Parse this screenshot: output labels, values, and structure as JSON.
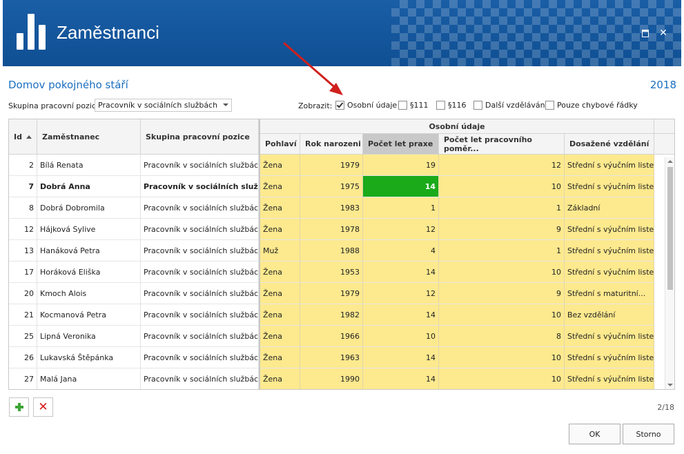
{
  "window": {
    "title": "Zaměstnanci",
    "maximize_icon": "maximize-icon",
    "close_glyph": "✕"
  },
  "header": {
    "organization": "Domov pokojného stáří",
    "year": "2018"
  },
  "filter": {
    "group_label": "Skupina pracovní pozice:",
    "group_value": "Pracovník v sociálních službách",
    "show_label": "Zobrazit:",
    "checkboxes": [
      {
        "label": "Osobní údaje",
        "checked": true
      },
      {
        "label": "§111",
        "checked": false
      },
      {
        "label": "§116",
        "checked": false
      },
      {
        "label": "Další vzdělávání",
        "checked": false
      },
      {
        "label": "Pouze chybové řádky",
        "checked": false
      }
    ]
  },
  "colors": {
    "titlebar": "#1a5ea6",
    "accent_text": "#1a6fc0",
    "highlight_yellow": "#fde98e",
    "highlight_green": "#1aaa1a",
    "annotation_arrow": "#d0201c"
  },
  "grid": {
    "group_header": "Osobní údaje",
    "columns": {
      "id": "Id",
      "employee": "Zaměstnanec",
      "group": "Skupina pracovní pozice",
      "gender": "Pohlaví",
      "birth_year": "Rok narozeni",
      "practice_years": "Počet let praxe",
      "employment_years": "Počet let pracovního poměr...",
      "education": "Dosažené vzdělání"
    },
    "rows": [
      {
        "id": "2",
        "name": "Bílá Renata",
        "group": "Pracovník v sociálních službách",
        "gender": "Žena",
        "birth": "1979",
        "practice": "19",
        "employment": "12",
        "education": "Střední s výučním listem"
      },
      {
        "id": "7",
        "name": "Dobrá Anna",
        "group": "Pracovník v sociálních službách",
        "gender": "Žena",
        "birth": "1975",
        "practice": "14",
        "employment": "10",
        "education": "Střední s výučním listem"
      },
      {
        "id": "8",
        "name": "Dobrá Dobromila",
        "group": "Pracovník v sociálních službách",
        "gender": "Žena",
        "birth": "1983",
        "practice": "1",
        "employment": "1",
        "education": "Základní"
      },
      {
        "id": "12",
        "name": "Hájková Sylive",
        "group": "Pracovník v sociálních službách",
        "gender": "Žena",
        "birth": "1978",
        "practice": "12",
        "employment": "9",
        "education": "Střední s výučním listem"
      },
      {
        "id": "13",
        "name": "Hanáková Petra",
        "group": "Pracovník v sociálních službách",
        "gender": "Muž",
        "birth": "1988",
        "practice": "4",
        "employment": "1",
        "education": "Střední s výučním listem"
      },
      {
        "id": "17",
        "name": "Horáková Eliška",
        "group": "Pracovník v sociálních službách",
        "gender": "Žena",
        "birth": "1953",
        "practice": "14",
        "employment": "10",
        "education": "Střední s výučním listem"
      },
      {
        "id": "20",
        "name": "Kmoch Alois",
        "group": "Pracovník v sociálních službách",
        "gender": "Žena",
        "birth": "1979",
        "practice": "12",
        "employment": "9",
        "education": "Střední s maturitní..."
      },
      {
        "id": "21",
        "name": "Kocmanová Petra",
        "group": "Pracovník v sociálních službách",
        "gender": "Žena",
        "birth": "1982",
        "practice": "14",
        "employment": "10",
        "education": "Bez vzdělání"
      },
      {
        "id": "25",
        "name": "Lipná Veronika",
        "group": "Pracovník v sociálních službách",
        "gender": "Žena",
        "birth": "1966",
        "practice": "10",
        "employment": "8",
        "education": "Střední s výučním listem"
      },
      {
        "id": "26",
        "name": "Lukavská Štěpánka",
        "group": "Pracovník v sociálních službách",
        "gender": "Žena",
        "birth": "1963",
        "practice": "14",
        "employment": "10",
        "education": "Střední s výučním listem"
      },
      {
        "id": "27",
        "name": "Malá Jana",
        "group": "Pracovník v sociálních službách",
        "gender": "Žena",
        "birth": "1990",
        "practice": "14",
        "employment": "10",
        "education": "Střední s výučním listem"
      }
    ],
    "selected_row_index": 1
  },
  "toolbar": {
    "add_icon": "plus-icon",
    "delete_glyph": "✕"
  },
  "pager": "2/18",
  "buttons": {
    "ok": "OK",
    "cancel": "Storno"
  }
}
